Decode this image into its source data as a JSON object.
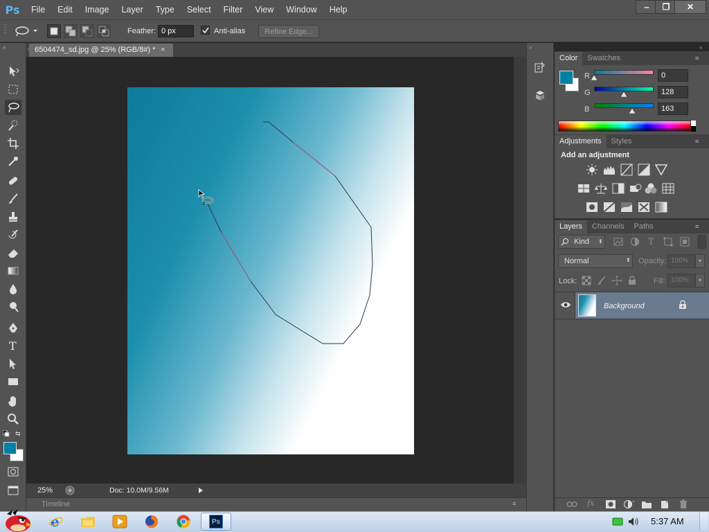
{
  "app": {
    "logo": "Ps"
  },
  "menu": [
    "File",
    "Edit",
    "Image",
    "Layer",
    "Type",
    "Select",
    "Filter",
    "View",
    "Window",
    "Help"
  ],
  "window_controls": {
    "minimize": "‒",
    "restore": "❐",
    "close": "✕"
  },
  "options_bar": {
    "feather_label": "Feather:",
    "feather_value": "0 px",
    "antialias_label": "Anti-alias",
    "refine_edge_label": "Refine Edge..."
  },
  "document": {
    "tab_title": "6504474_sd.jpg @ 25% (RGB/8#) *",
    "tab_close": "×",
    "zoom": "25%",
    "doc_size": "Doc: 10.0M/9.56M"
  },
  "timeline": {
    "label": "Timeline"
  },
  "color_panel": {
    "tabs": [
      "Color",
      "Swatches"
    ],
    "foreground_color": "#0080a3",
    "background_color": "#ffffff",
    "channels": [
      {
        "label": "R",
        "value": "0",
        "fraction": 0.0
      },
      {
        "label": "G",
        "value": "128",
        "fraction": 0.502
      },
      {
        "label": "B",
        "value": "163",
        "fraction": 0.639
      }
    ]
  },
  "adjustments_panel": {
    "tabs": [
      "Adjustments",
      "Styles"
    ],
    "heading": "Add an adjustment"
  },
  "layers_panel": {
    "tabs": [
      "Layers",
      "Channels",
      "Paths"
    ],
    "filter_kind": "Kind",
    "blend_mode": "Normal",
    "opacity_label": "Opacity:",
    "opacity_value": "100%",
    "lock_label": "Lock:",
    "fill_label": "Fill:",
    "fill_value": "100%",
    "layers": [
      {
        "name": "Background",
        "visible": true,
        "locked": true
      }
    ]
  },
  "taskbar": {
    "clock": "5:37 AM"
  }
}
